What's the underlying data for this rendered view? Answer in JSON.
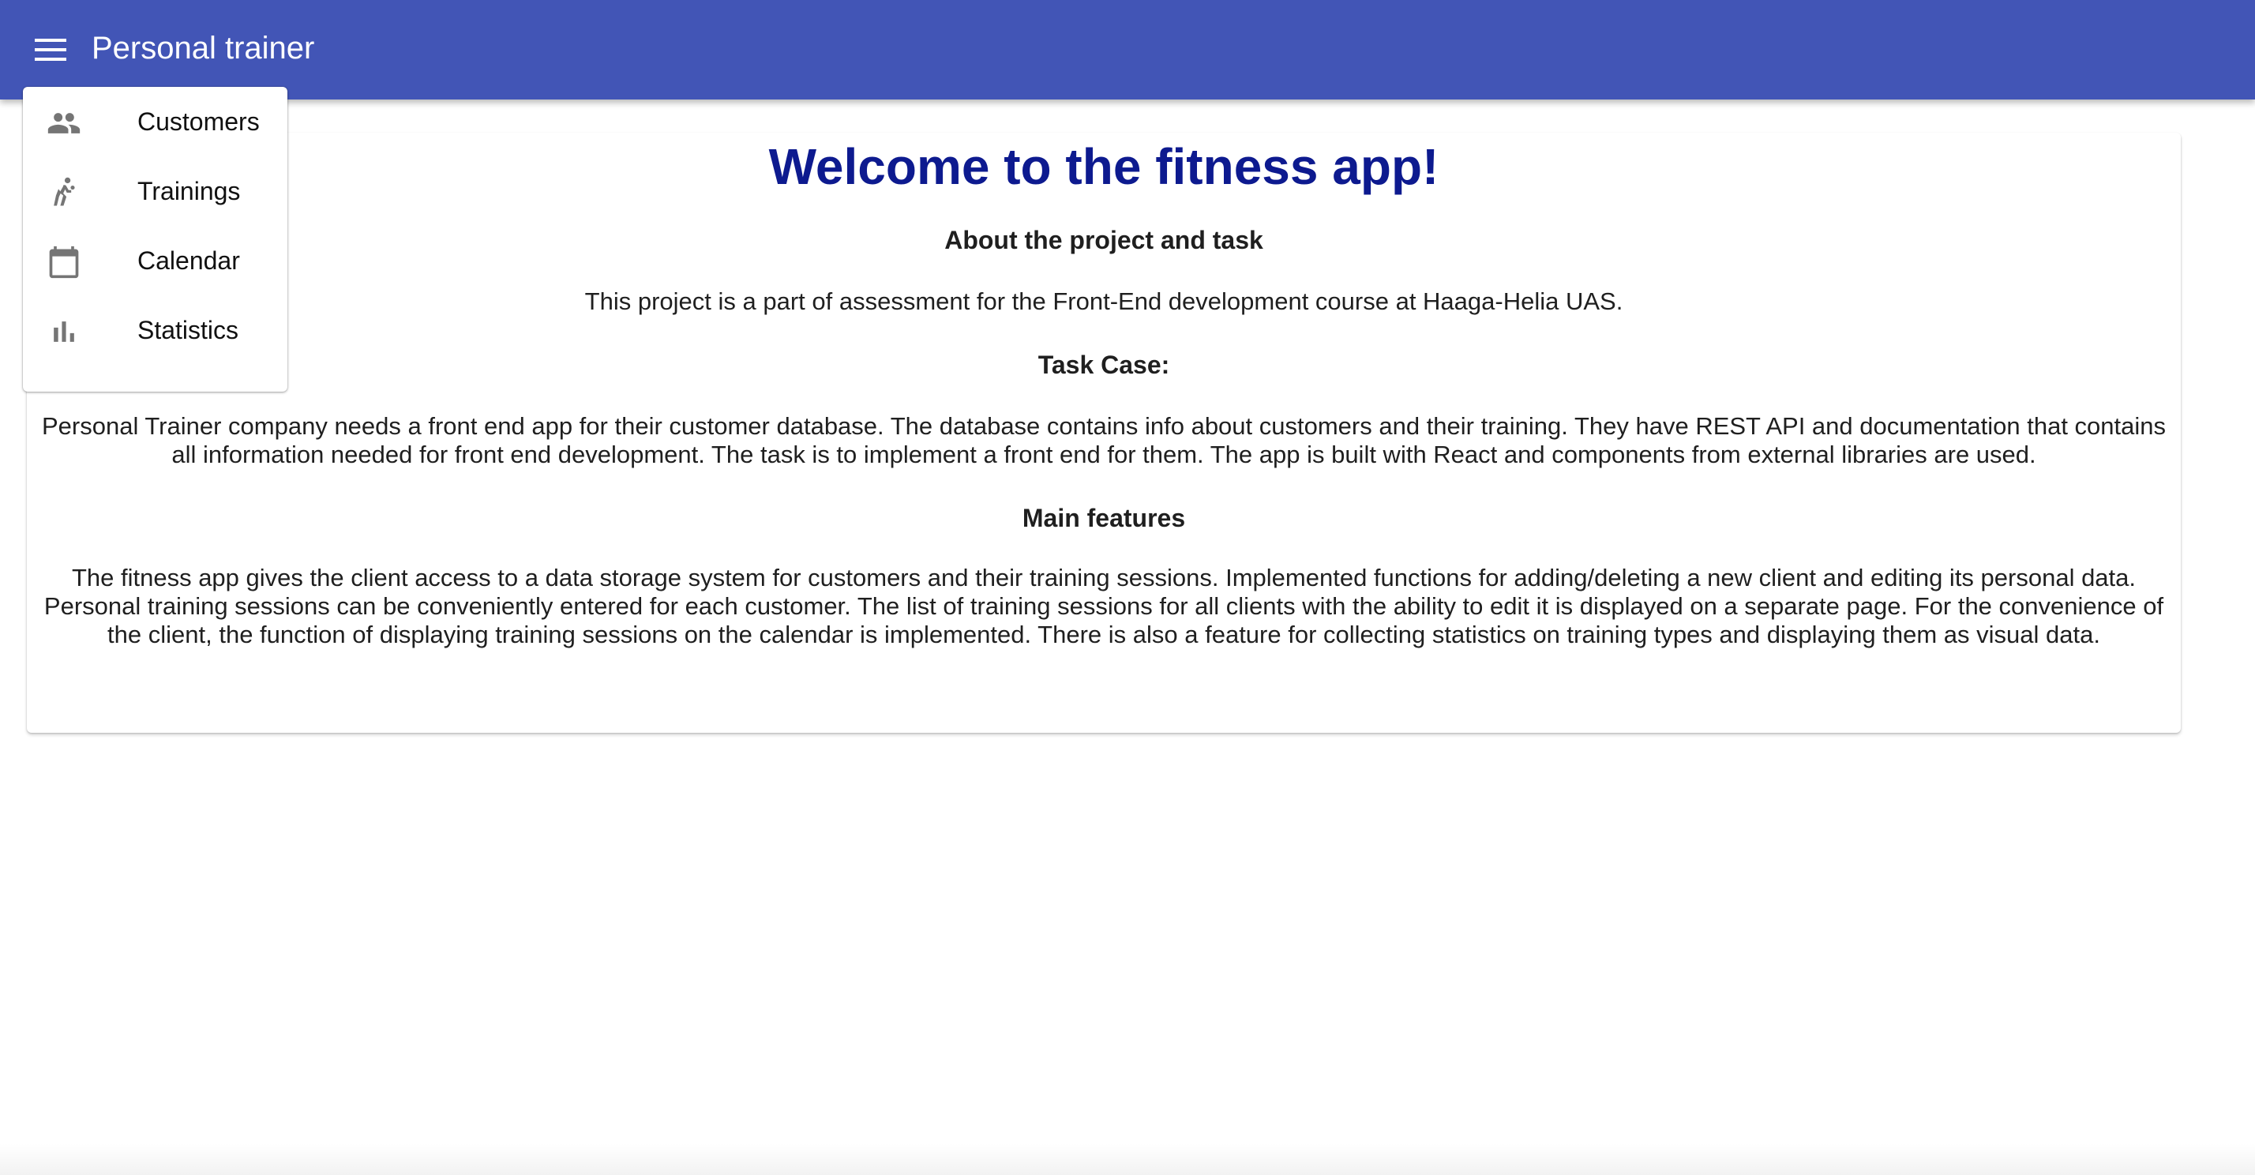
{
  "appbar": {
    "title": "Personal trainer",
    "color": "#4255b6",
    "menu_icon": "menu-icon"
  },
  "drawer": {
    "items": [
      {
        "label": "Customers",
        "icon": "people-icon"
      },
      {
        "label": "Trainings",
        "icon": "sports-icon"
      },
      {
        "label": "Calendar",
        "icon": "calendar-icon"
      },
      {
        "label": "Statistics",
        "icon": "bar-chart-icon"
      }
    ]
  },
  "main": {
    "title": "Welcome to the fitness app!",
    "title_color": "#0d1a8f",
    "about_heading": "About the project and task",
    "about_text": "This project is a part of assessment for the Front-End development course at Haaga-Helia UAS.",
    "task_heading": "Task Case:",
    "task_text": "Personal Trainer company needs a front end app for their customer database. The database contains info about customers and their training. They have REST API and documentation that contains all information needed for front end development. The task is to implement a front end for them. The app is built with React and components from external libraries are used.",
    "features_heading": "Main features",
    "features_text": "The fitness app gives the client access to a data storage system for customers and their training sessions. Implemented functions for adding/deleting a new client and editing its personal data. Personal training sessions can be conveniently entered for each customer. The list of training sessions for all clients with the ability to edit it is displayed on a separate page. For the convenience of the client, the function of displaying training sessions on the calendar is implemented. There is also a feature for collecting statistics on training types and displaying them as visual data."
  }
}
